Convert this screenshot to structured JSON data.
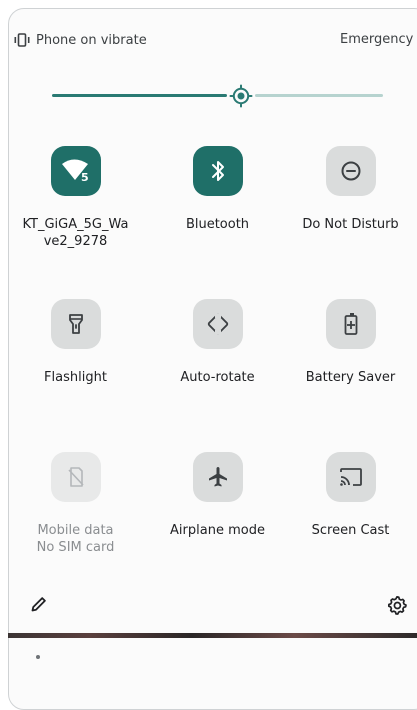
{
  "status": {
    "vibrate_label": "Phone on vibrate",
    "emergency_label": "Emergency ca"
  },
  "brightness": {
    "level": 0.57,
    "accent": "#2a7a73"
  },
  "tiles": [
    {
      "label": "KT_GiGA_5G_Wa",
      "label2": "ve2_9278",
      "icon": "wifi-5g-icon",
      "state": "on"
    },
    {
      "label": "Bluetooth",
      "icon": "bluetooth-icon",
      "state": "on"
    },
    {
      "label": "Do Not Disturb",
      "icon": "do-not-disturb-icon",
      "state": "off"
    },
    {
      "label": "Flashlight",
      "icon": "flashlight-icon",
      "state": "off"
    },
    {
      "label": "Auto-rotate",
      "icon": "auto-rotate-icon",
      "state": "off"
    },
    {
      "label": "Battery Saver",
      "icon": "battery-saver-icon",
      "state": "off"
    },
    {
      "label": "Mobile data",
      "sub": "No SIM card",
      "icon": "mobile-data-off-icon",
      "state": "disabled"
    },
    {
      "label": "Airplane mode",
      "icon": "airplane-icon",
      "state": "off"
    },
    {
      "label": "Screen Cast",
      "icon": "cast-icon",
      "state": "off"
    }
  ],
  "footer": {
    "edit_icon": "edit-pencil-icon",
    "settings_icon": "settings-gear-icon"
  }
}
